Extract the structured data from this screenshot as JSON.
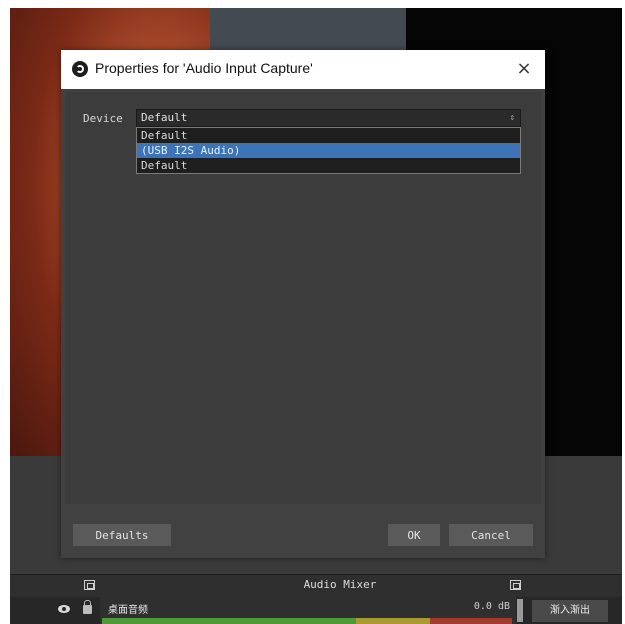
{
  "dialog": {
    "title": "Properties for 'Audio Input Capture'",
    "close_glyph": "×",
    "device_label": "Device",
    "device_value": "Default",
    "select_arrow": "⇕",
    "options": [
      {
        "label": "Default",
        "selected": false
      },
      {
        "label": "(USB I2S Audio)",
        "selected": true
      },
      {
        "label": "Default",
        "selected": false
      }
    ],
    "buttons": {
      "defaults": "Defaults",
      "ok": "OK",
      "cancel": "Cancel"
    }
  },
  "main_window": {
    "audio_mixer_title": "Audio Mixer",
    "mixer_source_name": "桌面音频",
    "mixer_db": "0.0 dB",
    "transition_button": "渐入渐出"
  },
  "colors": {
    "selection": "#3d74b8",
    "dialog_bg": "#414141",
    "meter_green": "#4e9a3a",
    "meter_yellow": "#a99a32",
    "meter_red": "#a33a2e"
  }
}
